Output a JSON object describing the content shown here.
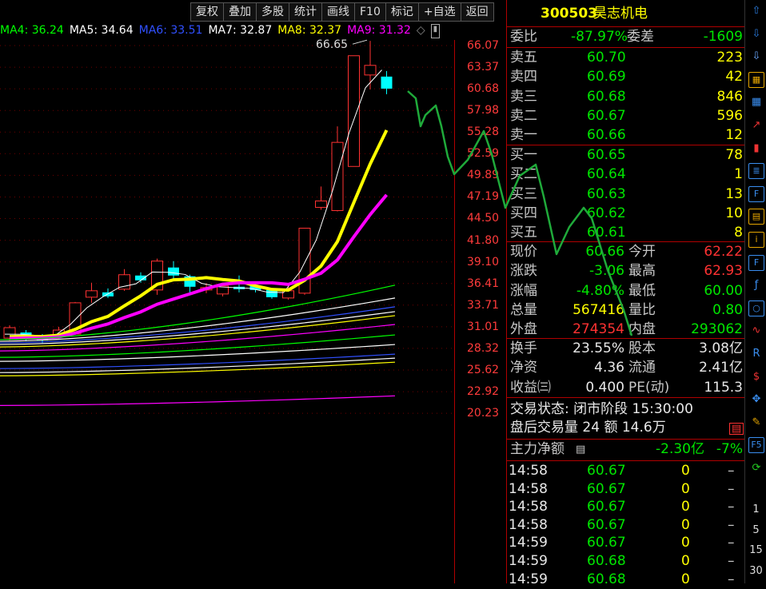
{
  "toolbar": [
    "复权",
    "叠加",
    "多股",
    "统计",
    "画线",
    "F10",
    "标记",
    "+自选",
    "返回"
  ],
  "ma_legend": [
    {
      "label": "MA4: 36.24",
      "color": "#00ff00"
    },
    {
      "label": "MA5: 34.64",
      "color": "#ffffff"
    },
    {
      "label": "MA6: 33.51",
      "color": "#3050ff"
    },
    {
      "label": "MA7: 32.87",
      "color": "#ffffff"
    },
    {
      "label": "MA8: 32.37",
      "color": "#ffff00"
    },
    {
      "label": "MA9: 31.32",
      "color": "#ff00ff"
    }
  ],
  "price_ticks": [
    "66.07",
    "63.37",
    "60.68",
    "57.98",
    "55.28",
    "52.59",
    "49.89",
    "47.19",
    "44.50",
    "41.80",
    "39.10",
    "36.41",
    "33.71",
    "31.01",
    "28.32",
    "25.62",
    "22.92",
    "20.23"
  ],
  "max_label": "66.65",
  "stock": {
    "code": "300503",
    "name": "昊志机电"
  },
  "weibi": {
    "label": "委比",
    "value": "-87.97%",
    "diff_label": "委差",
    "diff": "-1609"
  },
  "asks": [
    {
      "label": "卖五",
      "price": "60.70",
      "vol": "223"
    },
    {
      "label": "卖四",
      "price": "60.69",
      "vol": "42"
    },
    {
      "label": "卖三",
      "price": "60.68",
      "vol": "846"
    },
    {
      "label": "卖二",
      "price": "60.67",
      "vol": "596"
    },
    {
      "label": "卖一",
      "price": "60.66",
      "vol": "12"
    }
  ],
  "bids": [
    {
      "label": "买一",
      "price": "60.65",
      "vol": "78"
    },
    {
      "label": "买二",
      "price": "60.64",
      "vol": "1"
    },
    {
      "label": "买三",
      "price": "60.63",
      "vol": "13"
    },
    {
      "label": "买四",
      "price": "60.62",
      "vol": "10"
    },
    {
      "label": "买五",
      "price": "60.61",
      "vol": "8"
    }
  ],
  "quote": [
    {
      "l1": "现价",
      "v1": "60.66",
      "c1": "green",
      "l2": "今开",
      "v2": "62.22",
      "c2": "red"
    },
    {
      "l1": "涨跌",
      "v1": "-3.06",
      "c1": "green",
      "l2": "最高",
      "v2": "62.93",
      "c2": "red"
    },
    {
      "l1": "涨幅",
      "v1": "-4.80%",
      "c1": "green",
      "l2": "最低",
      "v2": "60.00",
      "c2": "green"
    },
    {
      "l1": "总量",
      "v1": "567416",
      "c1": "yellow",
      "l2": "量比",
      "v2": "0.80",
      "c2": "green"
    },
    {
      "l1": "外盘",
      "v1": "274354",
      "c1": "red",
      "l2": "内盘",
      "v2": "293062",
      "c2": "green"
    }
  ],
  "fund": [
    {
      "l1": "换手",
      "v1": "23.55%",
      "l2": "股本",
      "v2": "3.08亿"
    },
    {
      "l1": "净资",
      "v1": "4.36",
      "l2": "流通",
      "v2": "2.41亿"
    },
    {
      "l1": "收益㈢",
      "v1": "0.400",
      "l2": "PE(动)",
      "v2": "115.3"
    }
  ],
  "status": {
    "trade_state": "交易状态: 闭市阶段 15:30:00",
    "after_hours": "盘后交易量 24 额 14.6万"
  },
  "main_flow": {
    "label": "主力净额",
    "value": "-2.30亿",
    "pct": "-7%"
  },
  "ticks": [
    {
      "time": "14:58",
      "price": "60.67",
      "vol": "0",
      "flag": "–"
    },
    {
      "time": "14:58",
      "price": "60.67",
      "vol": "0",
      "flag": "–"
    },
    {
      "time": "14:58",
      "price": "60.67",
      "vol": "0",
      "flag": "–"
    },
    {
      "time": "14:58",
      "price": "60.67",
      "vol": "0",
      "flag": "–"
    },
    {
      "time": "14:59",
      "price": "60.67",
      "vol": "0",
      "flag": "–"
    },
    {
      "time": "14:59",
      "price": "60.68",
      "vol": "0",
      "flag": "–"
    },
    {
      "time": "14:59",
      "price": "60.68",
      "vol": "0",
      "flag": "–"
    }
  ],
  "tool_icons": [
    "arrow-up-icon",
    "arrow-down-icon",
    "arrow-down-outline-icon",
    "report-icon",
    "grid-icon",
    "line-chart-icon",
    "candle-icon",
    "list-icon",
    "f10-icon",
    "finance-icon",
    "info-icon",
    "fiz-icon",
    "formula-icon",
    "circle-icon",
    "wave-icon",
    "rsi-icon",
    "dollar-icon",
    "move-icon",
    "pencil-icon",
    "f5-icon",
    "refresh-icon"
  ],
  "tool_nums": [
    "1",
    "5",
    "15",
    "30"
  ],
  "candles": [
    {
      "o": 29.6,
      "c": 30.9,
      "h": 31.2,
      "l": 29.3,
      "up": true
    },
    {
      "o": 30.3,
      "c": 29.6,
      "h": 30.6,
      "l": 29.2,
      "up": false
    },
    {
      "o": 29.9,
      "c": 29.3,
      "h": 30.1,
      "l": 29.0,
      "up": false
    },
    {
      "o": 29.9,
      "c": 30.6,
      "h": 31.0,
      "l": 29.7,
      "up": true
    },
    {
      "o": 30.1,
      "c": 34.0,
      "h": 34.1,
      "l": 30.0,
      "up": true
    },
    {
      "o": 34.7,
      "c": 35.5,
      "h": 36.5,
      "l": 34.0,
      "up": true
    },
    {
      "o": 35.3,
      "c": 34.8,
      "h": 35.8,
      "l": 34.6,
      "up": false
    },
    {
      "o": 35.7,
      "c": 37.5,
      "h": 38.2,
      "l": 35.5,
      "up": true
    },
    {
      "o": 37.4,
      "c": 36.8,
      "h": 37.8,
      "l": 36.5,
      "up": false
    },
    {
      "o": 35.6,
      "c": 39.2,
      "h": 39.5,
      "l": 35.0,
      "up": true
    },
    {
      "o": 38.4,
      "c": 37.4,
      "h": 39.2,
      "l": 37.0,
      "up": false
    },
    {
      "o": 37.3,
      "c": 36.0,
      "h": 37.5,
      "l": 35.3,
      "up": false
    },
    {
      "o": 35.6,
      "c": 35.9,
      "h": 36.4,
      "l": 35.2,
      "up": true
    },
    {
      "o": 35.1,
      "c": 36.1,
      "h": 36.4,
      "l": 34.8,
      "up": true
    },
    {
      "o": 36.0,
      "c": 35.7,
      "h": 37.4,
      "l": 35.3,
      "up": false
    },
    {
      "o": 36.1,
      "c": 35.6,
      "h": 36.3,
      "l": 35.3,
      "up": false
    },
    {
      "o": 35.6,
      "c": 34.7,
      "h": 35.8,
      "l": 34.5,
      "up": false
    },
    {
      "o": 34.6,
      "c": 35.5,
      "h": 36.2,
      "l": 34.4,
      "up": true
    },
    {
      "o": 35.2,
      "c": 43.3,
      "h": 43.3,
      "l": 35.0,
      "up": true
    },
    {
      "o": 45.9,
      "c": 46.7,
      "h": 48.5,
      "l": 45.6,
      "up": true
    },
    {
      "o": 45.5,
      "c": 54.0,
      "h": 56.0,
      "l": 45.4,
      "up": true
    },
    {
      "o": 51.0,
      "c": 64.8,
      "h": 64.8,
      "l": 51.0,
      "up": true
    },
    {
      "o": 62.4,
      "c": 63.6,
      "h": 66.65,
      "l": 60.6,
      "up": true
    },
    {
      "o": 62.2,
      "c": 60.7,
      "h": 62.9,
      "l": 60.0,
      "up": false
    }
  ]
}
